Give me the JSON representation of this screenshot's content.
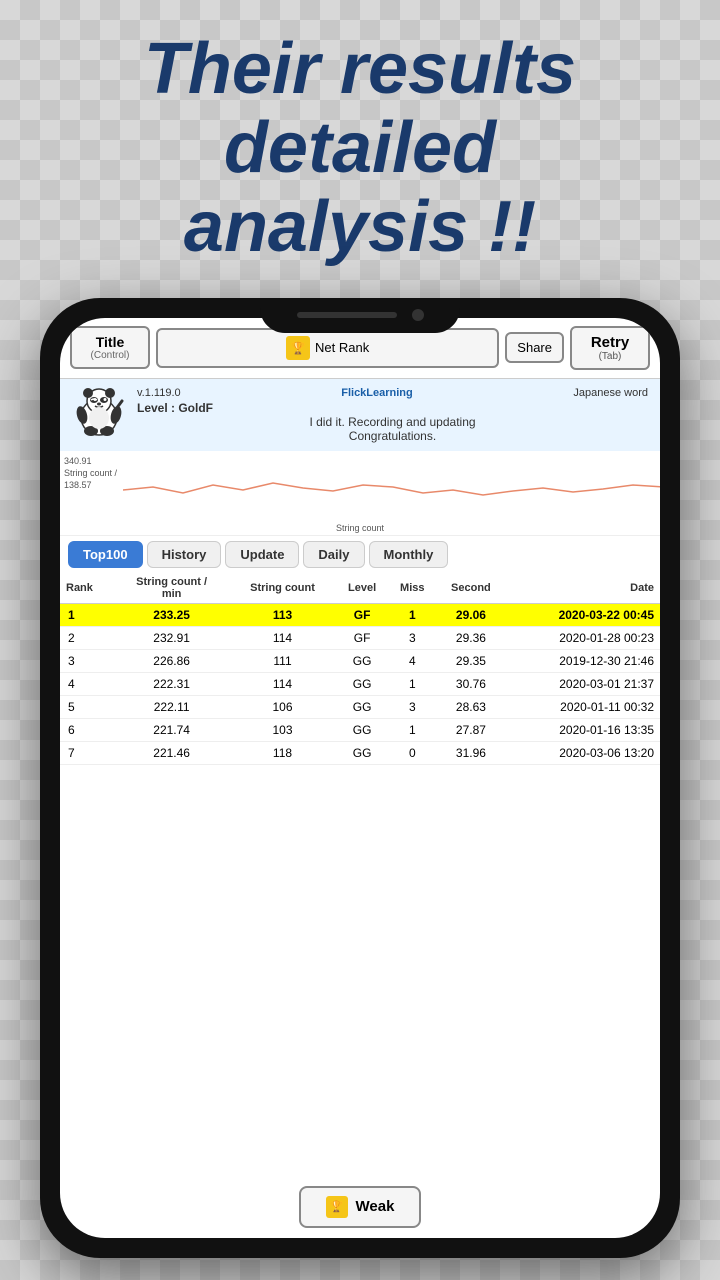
{
  "headline": {
    "line1": "Their results",
    "line2": "detailed",
    "line3": "analysis !!"
  },
  "nav": {
    "title_label": "Title",
    "title_sub": "(Control)",
    "net_rank_label": "Net Rank",
    "share_label": "Share",
    "retry_label": "Retry",
    "retry_sub": "(Tab)"
  },
  "info": {
    "version": "v.1.119.0",
    "app_name": "FlickLearning",
    "category": "Japanese word",
    "level": "Level : GoldF",
    "message": "I did it. Recording and updating",
    "message2": "Congratulations."
  },
  "chart": {
    "y_high": "340.91",
    "y_label": "String count /",
    "y_low": "138.57",
    "x_label": "String count"
  },
  "tabs": [
    {
      "id": "top100",
      "label": "Top100",
      "active": true
    },
    {
      "id": "history",
      "label": "History",
      "active": false
    },
    {
      "id": "update",
      "label": "Update",
      "active": false
    },
    {
      "id": "daily",
      "label": "Daily",
      "active": false
    },
    {
      "id": "monthly",
      "label": "Monthly",
      "active": false
    }
  ],
  "table": {
    "headers": [
      "Rank",
      "String count /\nmin",
      "String count",
      "Level",
      "Miss",
      "Second",
      "Date"
    ],
    "rows": [
      {
        "rank": "1",
        "sc_min": "233.25",
        "sc": "113",
        "level": "GF",
        "miss": "1",
        "second": "29.06",
        "date": "2020-03-22 00:45",
        "highlight": true
      },
      {
        "rank": "2",
        "sc_min": "232.91",
        "sc": "114",
        "level": "GF",
        "miss": "3",
        "second": "29.36",
        "date": "2020-01-28 00:23",
        "highlight": false
      },
      {
        "rank": "3",
        "sc_min": "226.86",
        "sc": "111",
        "level": "GG",
        "miss": "4",
        "second": "29.35",
        "date": "2019-12-30 21:46",
        "highlight": false
      },
      {
        "rank": "4",
        "sc_min": "222.31",
        "sc": "114",
        "level": "GG",
        "miss": "1",
        "second": "30.76",
        "date": "2020-03-01 21:37",
        "highlight": false
      },
      {
        "rank": "5",
        "sc_min": "222.11",
        "sc": "106",
        "level": "GG",
        "miss": "3",
        "second": "28.63",
        "date": "2020-01-11 00:32",
        "highlight": false
      },
      {
        "rank": "6",
        "sc_min": "221.74",
        "sc": "103",
        "level": "GG",
        "miss": "1",
        "second": "27.87",
        "date": "2020-01-16 13:35",
        "highlight": false
      },
      {
        "rank": "7",
        "sc_min": "221.46",
        "sc": "118",
        "level": "GG",
        "miss": "0",
        "second": "31.96",
        "date": "2020-03-06 13:20",
        "highlight": false
      }
    ]
  },
  "weak_btn": {
    "label": "Weak"
  }
}
